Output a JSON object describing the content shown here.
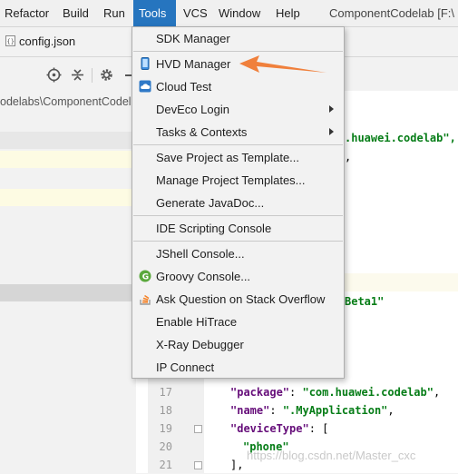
{
  "menubar": {
    "items": [
      "Refactor",
      "Build",
      "Run",
      "Tools",
      "VCS",
      "Window",
      "Help"
    ],
    "active": "Tools",
    "window_title": "ComponentCodelab [F:\\"
  },
  "file_tab": {
    "name": "config.json",
    "icon": "json-file-icon"
  },
  "toolbar": {
    "icons": [
      "crosshair-icon",
      "collapse-icon",
      "gear-icon",
      "minimize-icon"
    ]
  },
  "path_bar": {
    "text": "odelabs\\ComponentCodel"
  },
  "tools_menu": {
    "items": [
      {
        "label": "SDK Manager",
        "icon": ""
      },
      {
        "label": "HVD Manager",
        "icon": "phone-icon"
      },
      {
        "label": "Cloud Test",
        "icon": "cloud-icon"
      },
      {
        "label": "DevEco Login",
        "submenu": true
      },
      {
        "label": "Tasks & Contexts",
        "submenu": true
      },
      {
        "label": "Save Project as Template..."
      },
      {
        "label": "Manage Project Templates..."
      },
      {
        "label": "Generate JavaDoc..."
      },
      {
        "label": "IDE Scripting Console"
      },
      {
        "label": "JShell Console..."
      },
      {
        "label": "Groovy Console...",
        "icon": "groovy-icon"
      },
      {
        "label": "Ask Question on Stack Overflow",
        "icon": "stackoverflow-icon"
      },
      {
        "label": "Enable HiTrace"
      },
      {
        "label": "X-Ray Debugger"
      },
      {
        "label": "IP Connect"
      }
    ],
    "annotation": "arrow-pointing-to-hvd-manager"
  },
  "editor": {
    "partial_lines": [
      ".huawei.codelab\",",
      ",",
      "Beta1\""
    ],
    "lines": [
      {
        "n": "17",
        "key": "\"package\"",
        "val": "\"com.huawei.codelab\"",
        "tail": ","
      },
      {
        "n": "18",
        "key": "\"name\"",
        "val": "\".MyApplication\"",
        "tail": ","
      },
      {
        "n": "19",
        "key": "\"deviceType\"",
        "val": "",
        "tail": ": ["
      },
      {
        "n": "20",
        "key": "",
        "val": "\"phone\"",
        "tail": ""
      },
      {
        "n": "21",
        "key": "",
        "val": "",
        "tail": "],"
      }
    ]
  },
  "watermark": "https://blog.csdn.net/Master_cxc",
  "colors": {
    "menu_active": "#2675bf",
    "annotation_arrow": "#f0803c"
  }
}
